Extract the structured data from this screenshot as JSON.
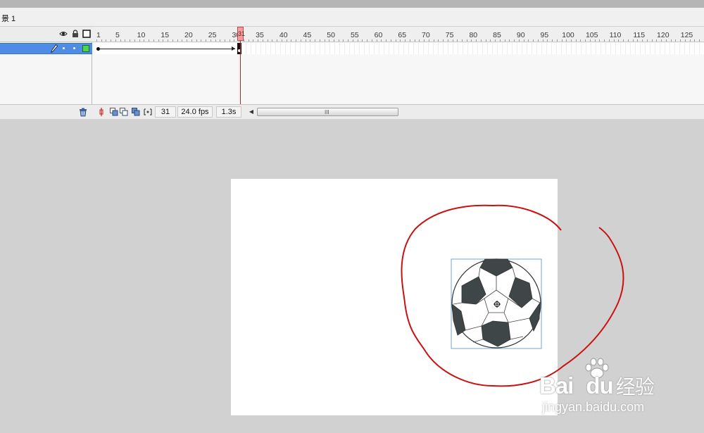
{
  "scene": {
    "label": "景 1"
  },
  "timeline": {
    "frame_numbers": [
      "1",
      "5",
      "10",
      "15",
      "20",
      "25",
      "30",
      "35",
      "40",
      "45",
      "50",
      "55",
      "60",
      "65",
      "70",
      "75",
      "80",
      "85",
      "90",
      "95",
      "100",
      "105",
      "110",
      "115",
      "120",
      "125"
    ],
    "playhead_frame": "31",
    "footer": {
      "current_frame": "31",
      "fps": "24.0 fps",
      "elapsed_time": "1.3s"
    },
    "scroll_grip": "III"
  },
  "stage": {
    "background": "#ffffff",
    "motion_path_color": "#cc1010",
    "bounding_box_color": "#6fa8c8"
  },
  "watermark": {
    "brand": "Bai",
    "brand_tail": "du",
    "brand_suffix": "经验",
    "url": "jingyan.baidu.com"
  }
}
